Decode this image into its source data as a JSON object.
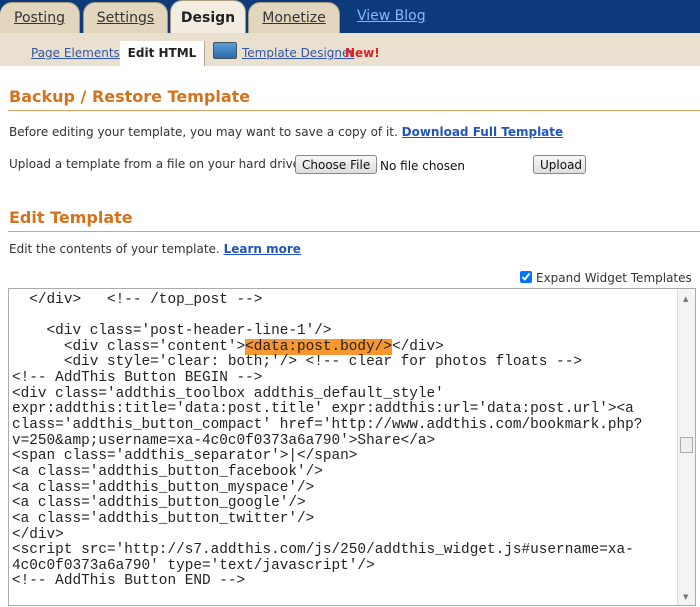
{
  "tabs": [
    "Posting",
    "Settings",
    "Design",
    "Monetize"
  ],
  "view_blog": "View Blog",
  "subnav": {
    "page_elements": "Page Elements",
    "edit_html": "Edit HTML",
    "template_designer": "Template Designer",
    "new_badge": "New!"
  },
  "backup": {
    "title": "Backup / Restore Template",
    "desc": "Before editing your template, you may want to save a copy of it.",
    "download_link": "Download Full Template",
    "upload_label": "Upload a template from a file on your hard drive:",
    "choose_file": "Choose File",
    "no_file": "No file chosen",
    "upload": "Upload"
  },
  "edit": {
    "title": "Edit Template",
    "desc": "Edit the contents of your template.",
    "learn_more": "Learn more",
    "expand_label": "Expand Widget Templates",
    "expand_checked": true
  },
  "code": {
    "before": [
      "    </div>",
      "  </div>   <!-- /top_post -->",
      "",
      "    <div class='post-header-line-1'/>"
    ],
    "hl_pre": "      <div class='content'>",
    "hl_text": "<data:post.body/>",
    "hl_post": "</div>",
    "after": [
      "      <div style='clear: both;'/> <!-- clear for photos floats -->",
      "<!-- AddThis Button BEGIN -->",
      "<div class='addthis_toolbox addthis_default_style'",
      "expr:addthis:title='data:post.title' expr:addthis:url='data:post.url'><a",
      "class='addthis_button_compact' href='http://www.addthis.com/bookmark.php?",
      "v=250&amp;username=xa-4c0c0f0373a6a790'>Share</a>",
      "<span class='addthis_separator'>|</span>",
      "<a class='addthis_button_facebook'/>",
      "<a class='addthis_button_myspace'/>",
      "<a class='addthis_button_google'/>",
      "<a class='addthis_button_twitter'/>",
      "</div>",
      "<script src='http://s7.addthis.com/js/250/addthis_widget.js#username=xa-",
      "4c0c0f0373a6a790' type='text/javascript'/>",
      "<!-- AddThis Button END -->"
    ]
  }
}
